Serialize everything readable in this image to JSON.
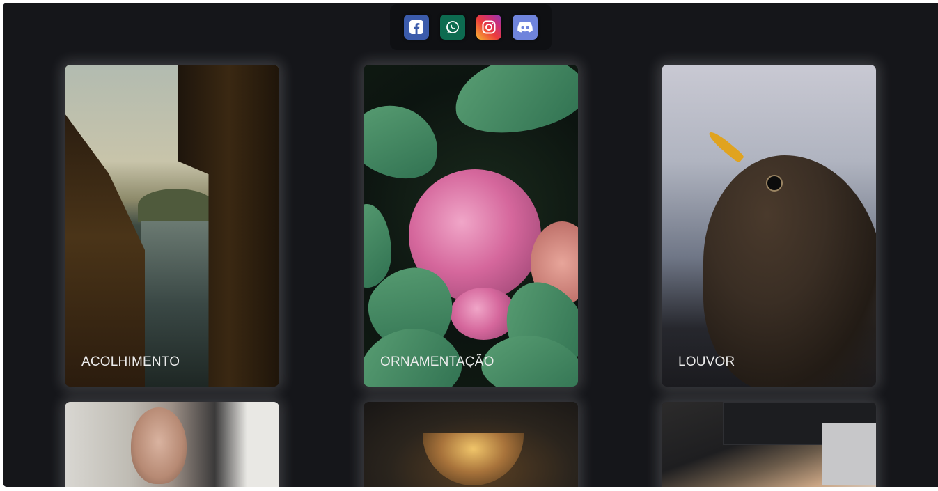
{
  "social": {
    "items": [
      {
        "name": "facebook",
        "icon": "facebook-icon",
        "color": "#3b5bab"
      },
      {
        "name": "whatsapp",
        "icon": "whatsapp-icon",
        "color": "#0d6b50"
      },
      {
        "name": "instagram",
        "icon": "instagram-icon",
        "color": "#e1306c"
      },
      {
        "name": "discord",
        "icon": "discord-icon",
        "color": "#6f84dc"
      }
    ]
  },
  "cards": [
    {
      "label": "ACOLHIMENTO",
      "image": "boathouses-lake-photo"
    },
    {
      "label": "ORNAMENTAÇÃO",
      "image": "pink-hydrangea-photo"
    },
    {
      "label": "LOUVOR",
      "image": "blackbird-photo"
    },
    {
      "label": "",
      "image": "smiling-woman-photo"
    },
    {
      "label": "",
      "image": "chandelier-photo"
    },
    {
      "label": "",
      "image": "audio-mixer-microphone-photo"
    }
  ],
  "colors": {
    "background": "#15161a",
    "card_text": "#ececec"
  }
}
